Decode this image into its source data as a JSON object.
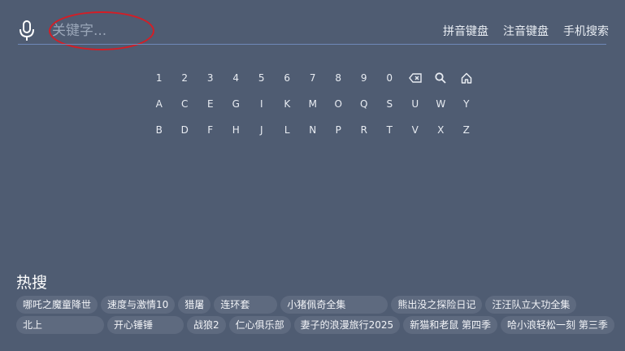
{
  "search": {
    "placeholder": "关键字..."
  },
  "keyboard_modes": [
    "拼音键盘",
    "注音键盘",
    "手机搜索"
  ],
  "keyboard_rows": [
    [
      "1",
      "2",
      "3",
      "4",
      "5",
      "6",
      "7",
      "8",
      "9",
      "0",
      "backspace-icon",
      "search-icon",
      "home-icon"
    ],
    [
      "A",
      "C",
      "E",
      "G",
      "I",
      "K",
      "M",
      "O",
      "Q",
      "S",
      "U",
      "W",
      "Y"
    ],
    [
      "B",
      "D",
      "F",
      "H",
      "J",
      "L",
      "N",
      "P",
      "R",
      "T",
      "V",
      "X",
      "Z"
    ]
  ],
  "hot": {
    "title": "热搜",
    "rows": [
      [
        "哪吒之魔童降世",
        "速度与激情10",
        "猎屠",
        "连环套",
        "小猪佩奇全集",
        "熊出没之探险日记",
        "汪汪队立大功全集"
      ],
      [
        "北上",
        "开心锤锤",
        "战狼2",
        "仁心俱乐部",
        "妻子的浪漫旅行2025",
        "新猫和老鼠 第四季",
        "哈小浪轻松一刻 第三季"
      ]
    ]
  },
  "colors": {
    "background": "#4f5c72",
    "chip": "#5e6a7f",
    "underline": "#6f88b8",
    "annotation": "#d51d25"
  }
}
